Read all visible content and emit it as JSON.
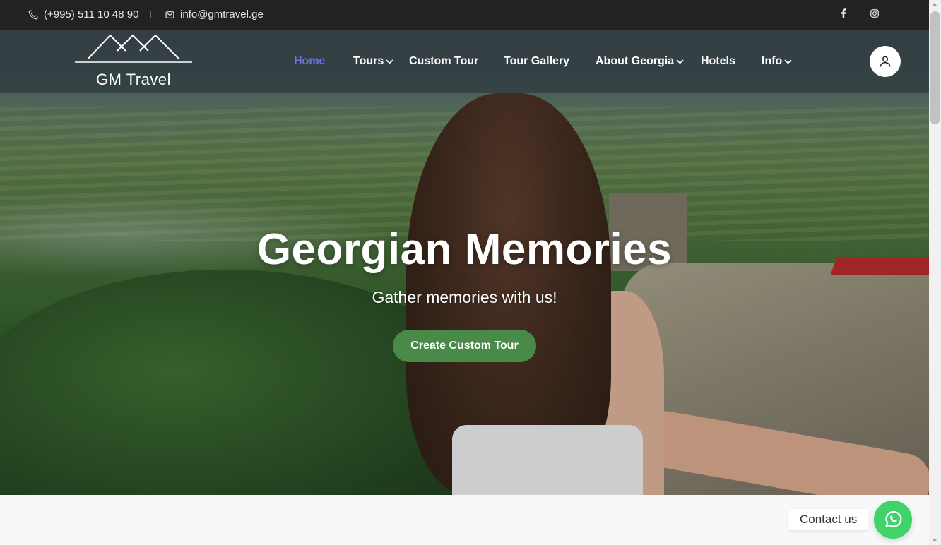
{
  "topbar": {
    "phone": "(+995) 511 10 48 90",
    "email": "info@gmtravel.ge",
    "social_icons": [
      "facebook-icon",
      "instagram-icon"
    ]
  },
  "header": {
    "logo_text": "GM Travel",
    "nav": {
      "home": "Home",
      "tours": "Tours",
      "custom_tour": "Custom Tour",
      "tour_gallery": "Tour Gallery",
      "about_georgia": "About Georgia",
      "hotels": "Hotels",
      "info": "Info"
    },
    "active_color": "#6b73e6"
  },
  "hero": {
    "title": "Georgian Memories",
    "subtitle": "Gather memories with us!",
    "cta_label": "Create Custom Tour",
    "cta_color": "#4a8a48"
  },
  "contact": {
    "label": "Contact us",
    "whatsapp_color": "#3fd36a"
  }
}
